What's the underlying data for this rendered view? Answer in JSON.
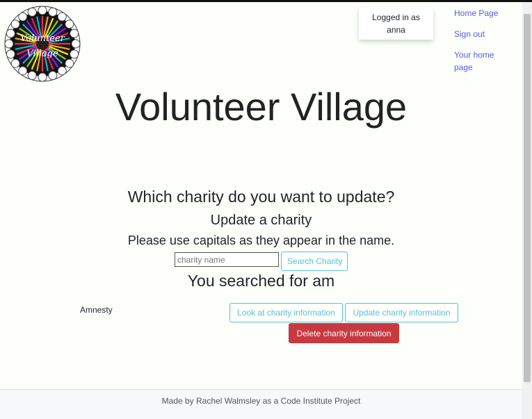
{
  "app": {
    "title": "Volunteer Village",
    "logo_text_line1": "Volunteer",
    "logo_text_line2": "Village"
  },
  "login": {
    "line1": "Logged in as",
    "line2": "anna"
  },
  "nav": {
    "items": [
      {
        "label": "Home Page"
      },
      {
        "label": "Sign out"
      },
      {
        "label": "Your home page"
      }
    ]
  },
  "headings": {
    "which": "Which charity do you want to update?",
    "update": "Update a charity",
    "note": "Please use capitals as they appear in the name.",
    "result": "You searched for am"
  },
  "search": {
    "placeholder": "charity name",
    "value": "",
    "button_label": "Search Charity"
  },
  "results": [
    {
      "name": "Amnesty",
      "look_label": "Look at charity information",
      "update_label": "Update charity information",
      "delete_label": "Delete charity information"
    }
  ],
  "footer": {
    "text": "Made by Rachel Walmsley as a Code Institute Project"
  },
  "colors": {
    "link": "#5a5ae6",
    "info": "#5bc0de",
    "danger": "#c8393f",
    "background": "#fcfffa"
  }
}
